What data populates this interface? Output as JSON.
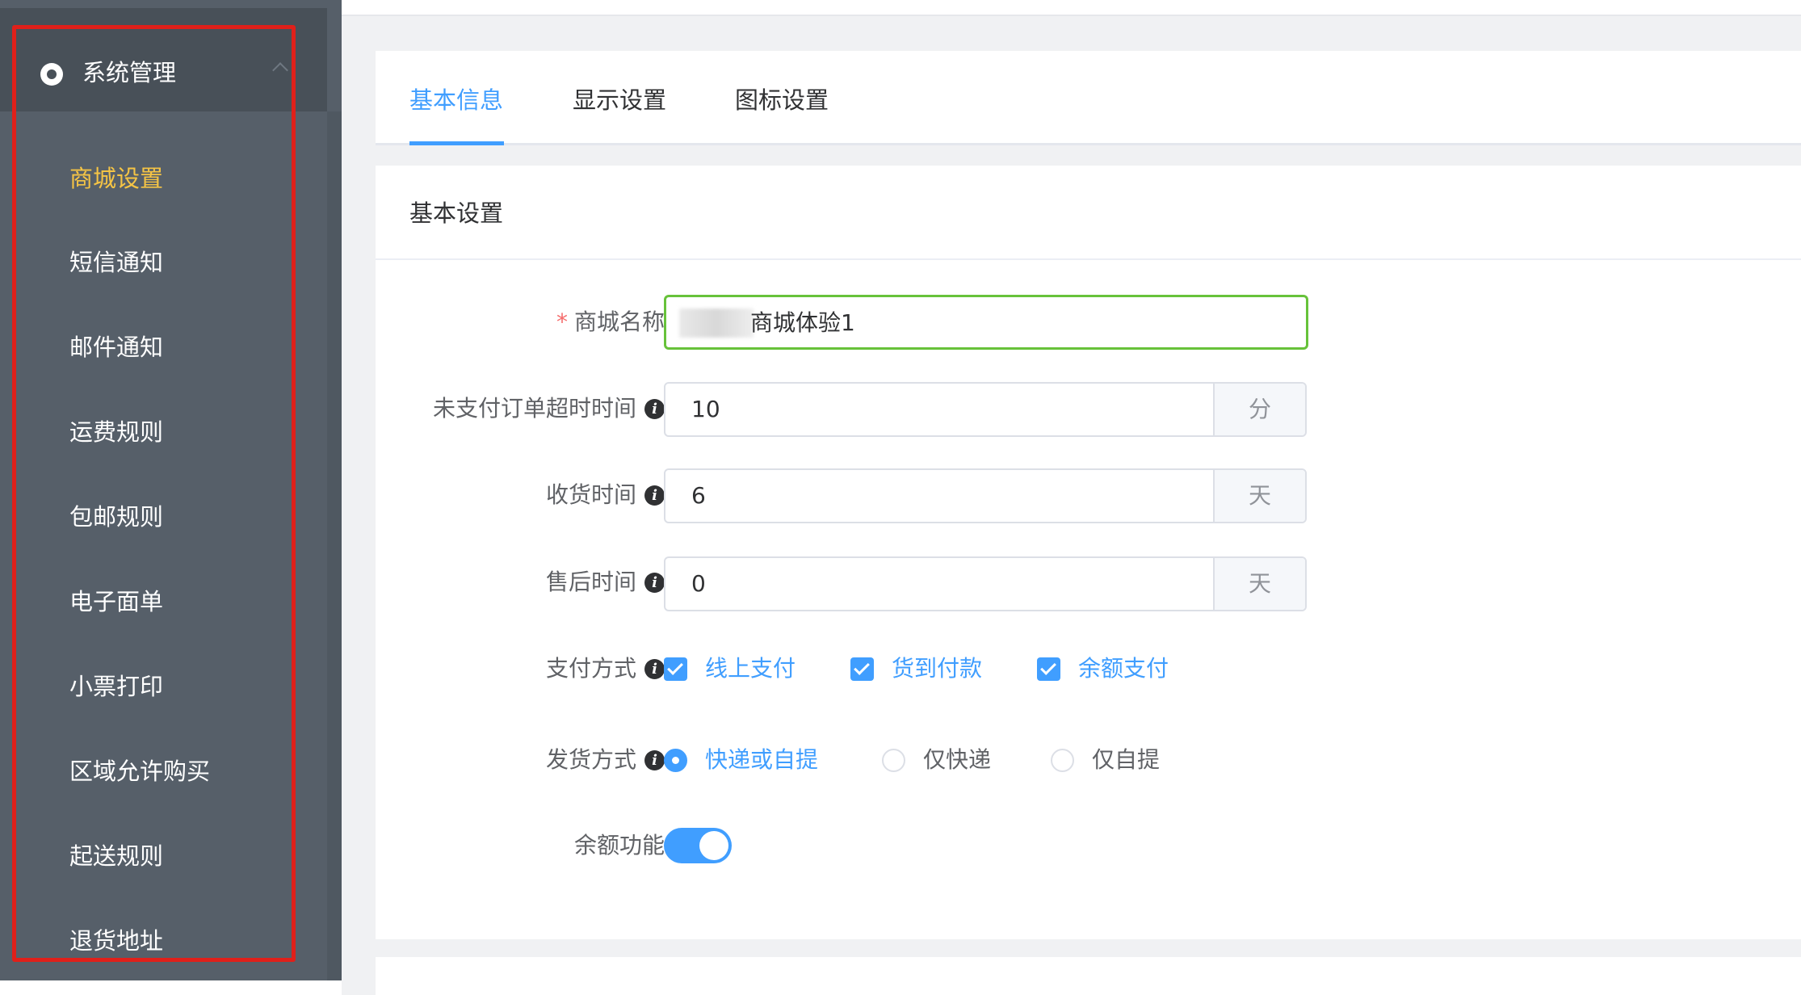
{
  "sidebar": {
    "header_title": "系统管理",
    "items": [
      {
        "label": "商城设置",
        "active": true
      },
      {
        "label": "短信通知"
      },
      {
        "label": "邮件通知"
      },
      {
        "label": "运费规则"
      },
      {
        "label": "包邮规则"
      },
      {
        "label": "电子面单"
      },
      {
        "label": "小票打印"
      },
      {
        "label": "区域允许购买"
      },
      {
        "label": "起送规则"
      },
      {
        "label": "退货地址"
      }
    ]
  },
  "tabs": [
    {
      "label": "基本信息",
      "active": true
    },
    {
      "label": "显示设置"
    },
    {
      "label": "图标设置"
    }
  ],
  "section_title": "基本设置",
  "form": {
    "shop_name": {
      "label": "商城名称",
      "value": "商城体验1",
      "required": true
    },
    "unpaid_timeout": {
      "label": "未支付订单超时时间",
      "value": "10",
      "unit": "分"
    },
    "receive_time": {
      "label": "收货时间",
      "value": "6",
      "unit": "天"
    },
    "aftersale_time": {
      "label": "售后时间",
      "value": "0",
      "unit": "天"
    },
    "payment": {
      "label": "支付方式",
      "options": [
        {
          "label": "线上支付",
          "checked": true
        },
        {
          "label": "货到付款",
          "checked": true
        },
        {
          "label": "余额支付",
          "checked": true
        }
      ]
    },
    "delivery": {
      "label": "发货方式",
      "options": [
        {
          "label": "快递或自提",
          "selected": true
        },
        {
          "label": "仅快递",
          "selected": false
        },
        {
          "label": "仅自提",
          "selected": false
        }
      ]
    },
    "balance": {
      "label": "余额功能",
      "enabled": true
    }
  },
  "colors": {
    "accent": "#409eff",
    "active_menu": "#f5c445",
    "highlight_box": "#e0201a",
    "sidebar_bg": "#565f69"
  }
}
